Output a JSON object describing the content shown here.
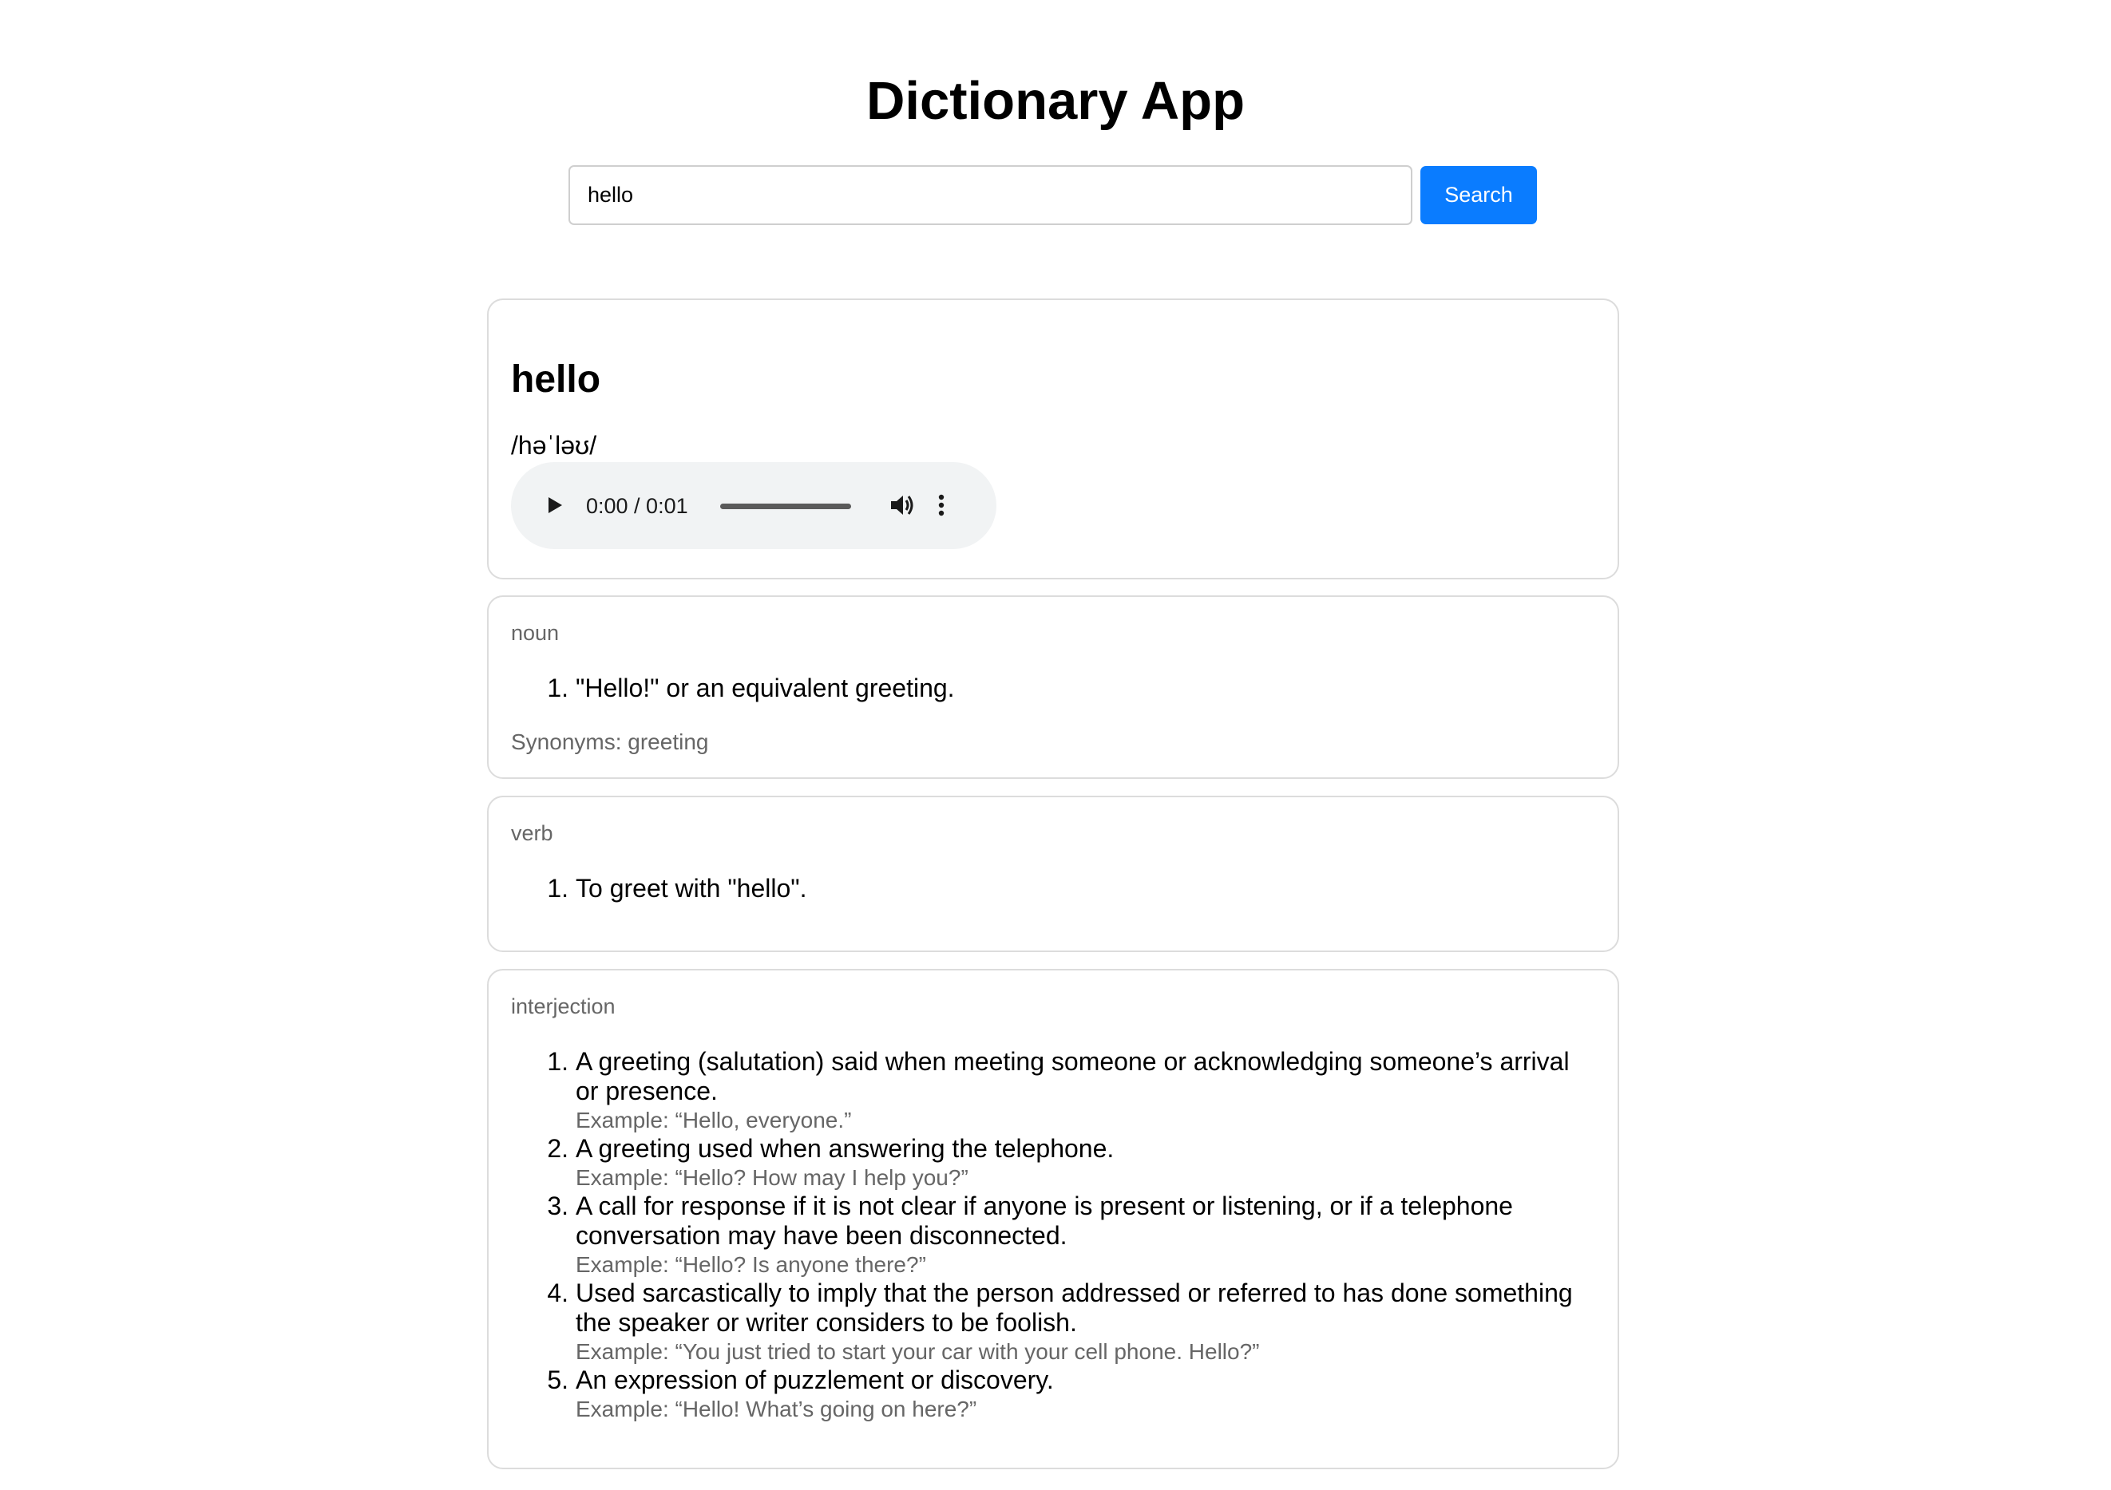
{
  "app": {
    "title": "Dictionary App"
  },
  "search": {
    "value": "hello",
    "button_label": "Search"
  },
  "entry": {
    "word": "hello",
    "phonetic": "/həˈləʊ/",
    "audio": {
      "time": "0:00 / 0:01",
      "progress_fraction": 0,
      "icons": [
        "play-icon",
        "volume-icon",
        "more-options-icon"
      ]
    }
  },
  "meanings": [
    {
      "part_of_speech": "noun",
      "definitions": [
        {
          "number": "1.",
          "text": "\"Hello!\" or an equivalent greeting."
        }
      ],
      "synonyms": "Synonyms: greeting"
    },
    {
      "part_of_speech": "verb",
      "definitions": [
        {
          "number": "1.",
          "text": "To greet with \"hello\"."
        }
      ]
    },
    {
      "part_of_speech": "interjection",
      "definitions": [
        {
          "number": "1.",
          "text": "A greeting (salutation) said when meeting someone or acknowledging someone’s arrival or presence.",
          "example": "Example: “Hello, everyone.”"
        },
        {
          "number": "2.",
          "text": "A greeting used when answering the telephone.",
          "example": "Example: “Hello? How may I help you?”"
        },
        {
          "number": "3.",
          "text": "A call for response if it is not clear if anyone is present or listening, or if a telephone conversation may have been disconnected.",
          "example": "Example: “Hello? Is anyone there?”"
        },
        {
          "number": "4.",
          "text": "Used sarcastically to imply that the person addressed or referred to has done something the speaker or writer considers to be foolish.",
          "example": "Example: “You just tried to start your car with your cell phone. Hello?”"
        },
        {
          "number": "5.",
          "text": "An expression of puzzlement or discovery.",
          "example": "Example: “Hello! What’s going on here?”"
        }
      ]
    }
  ],
  "colors": {
    "accent": "#0a7cff",
    "muted_text": "#666666",
    "card_border": "#dcdcdc",
    "player_bg": "#f1f3f4"
  }
}
